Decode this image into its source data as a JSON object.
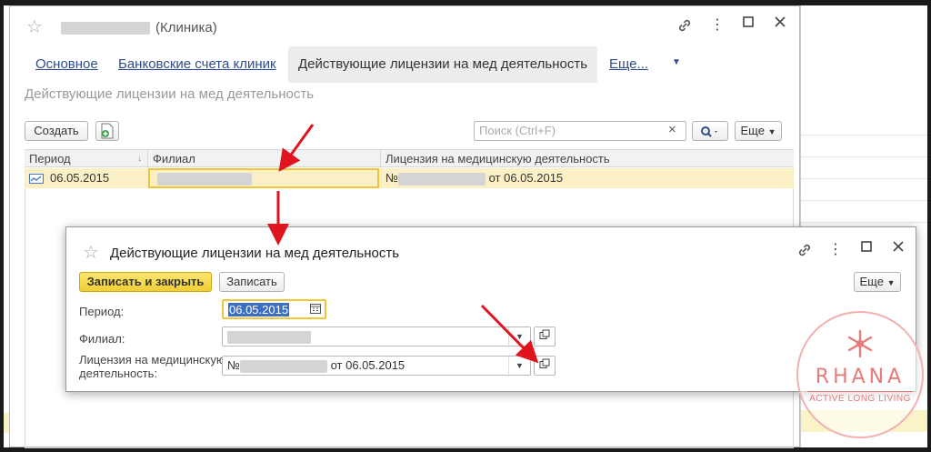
{
  "main_window": {
    "title_suffix": "(Клиника)",
    "tabs": [
      {
        "label": "Основное"
      },
      {
        "label": "Банковские счета клиник"
      },
      {
        "label": "Действующие лицензии на мед деятельность"
      },
      {
        "label": "Еще..."
      }
    ],
    "subtitle": "Действующие лицензии на мед деятельность",
    "toolbar": {
      "create_label": "Создать",
      "search_placeholder": "Поиск (Ctrl+F)",
      "clear_glyph": "×",
      "more_label": "Еще"
    },
    "table": {
      "columns": [
        "Период",
        "Филиал",
        "Лицензия на медицинскую деятельность"
      ],
      "rows": [
        {
          "period": "06.05.2015",
          "license_prefix": "№",
          "license_suffix": "от 06.05.2015"
        }
      ]
    }
  },
  "dialog": {
    "title": "Действующие лицензии на мед деятельность",
    "save_close_label": "Записать и закрыть",
    "save_label": "Записать",
    "more_label": "Еще",
    "fields": {
      "period_label": "Период:",
      "period_value": "06.05.2015",
      "branch_label": "Филиал:",
      "license_label_line1": "Лицензия на медицинскую",
      "license_label_line2": "деятельность:",
      "license_prefix": "№",
      "license_suffix": "от 06.05.2015"
    }
  },
  "logo": {
    "name": "RHANA",
    "tagline": "ACTIVE LONG LIVING"
  },
  "colors": {
    "accent_link": "#2e4d8e",
    "selected_row": "#fbf0c5",
    "primary_button": "#f0cf35",
    "annotation_arrow": "#e0141e",
    "logo": "#e77b7b"
  }
}
